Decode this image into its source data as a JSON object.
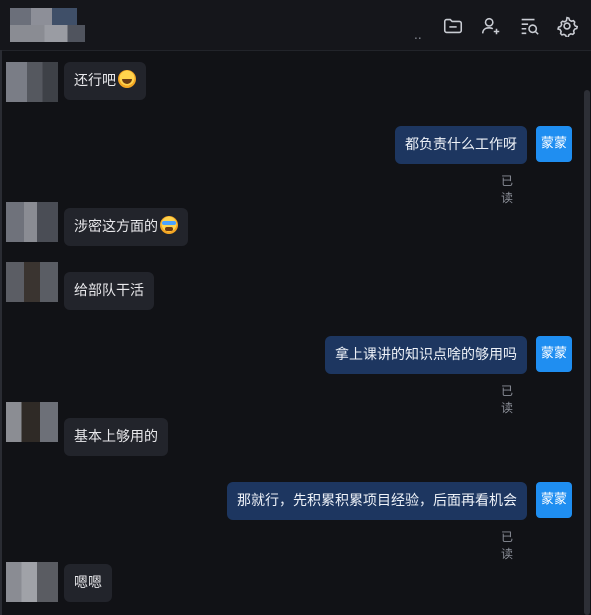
{
  "header": {
    "title_suffix": "..",
    "icons": [
      {
        "name": "folder-icon"
      },
      {
        "name": "add-user-icon"
      },
      {
        "name": "search-list-icon"
      },
      {
        "name": "settings-icon"
      }
    ]
  },
  "messages": [
    {
      "side": "left",
      "text": "还行吧",
      "emoji": "smile"
    },
    {
      "side": "right",
      "text": "都负责什么工作呀",
      "avatar_label": "蒙蒙",
      "status": "已读"
    },
    {
      "side": "left",
      "text": "涉密这方面的",
      "emoji": "cry"
    },
    {
      "side": "left",
      "text": "给部队干活"
    },
    {
      "side": "right",
      "text": "拿上课讲的知识点啥的够用吗",
      "avatar_label": "蒙蒙",
      "status": "已读"
    },
    {
      "side": "left",
      "text": "基本上够用的"
    },
    {
      "side": "right",
      "text": "那就行，先积累积累项目经验，后面再看机会",
      "avatar_label": "蒙蒙",
      "status": "已读"
    },
    {
      "side": "left",
      "text": "嗯嗯"
    }
  ]
}
